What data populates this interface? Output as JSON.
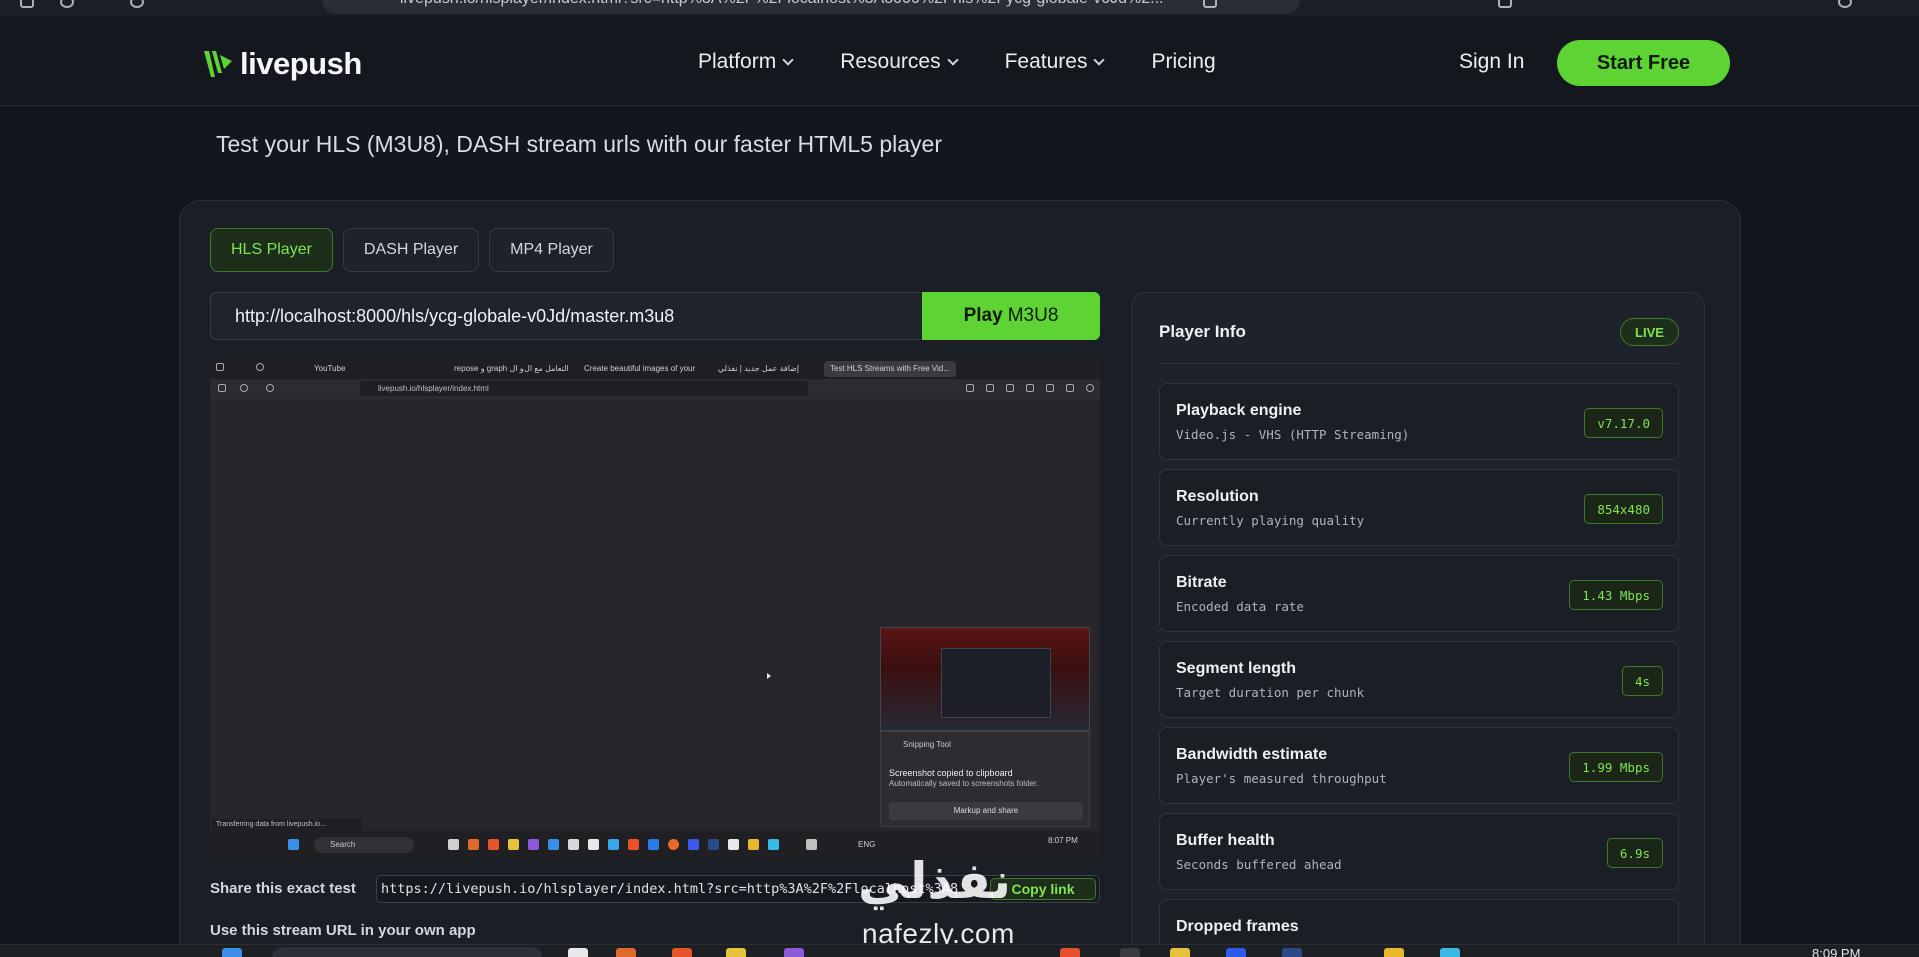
{
  "browser": {
    "url": "livepush.io/hlsplayer/index.html?src=http%3A%2F%2Flocalhost%3A8000%2Fhls%2Fycg-globale-v0Jd%2..."
  },
  "header": {
    "logo_text": "livepush",
    "nav": [
      {
        "label": "Platform",
        "has_dropdown": true
      },
      {
        "label": "Resources",
        "has_dropdown": true
      },
      {
        "label": "Features",
        "has_dropdown": true
      },
      {
        "label": "Pricing",
        "has_dropdown": false
      }
    ],
    "sign_in": "Sign In",
    "start_free": "Start Free"
  },
  "tagline": "Test your HLS (M3U8), DASH stream urls with our faster HTML5 player",
  "player_tabs": [
    {
      "label": "HLS Player",
      "active": true
    },
    {
      "label": "DASH Player",
      "active": false
    },
    {
      "label": "MP4 Player",
      "active": false
    }
  ],
  "stream_url": "http://localhost:8000/hls/ycg-globale-v0Jd/master.m3u8",
  "play_button": {
    "bold": "Play",
    "rest": "M3U8"
  },
  "player_screen": {
    "tabs": [
      "YouTube",
      "repose و graph و ال",
      "التعامل مع ال",
      "Create beautiful images of your",
      "إضافة عمل جديد | نفذلي",
      "Test HLS Streams with Free Vid..."
    ],
    "address": "livepush.io/hlsplayer/index.html",
    "status": "Transferring data from livepush.io...",
    "taskbar_search": "Search",
    "snip": {
      "app": "Snipping Tool",
      "title": "Screenshot copied to clipboard",
      "detail": "Automatically saved to screenshots folder.",
      "button": "Markup and share"
    },
    "tray": {
      "lang": "ENG",
      "time": "8:07 PM"
    }
  },
  "share": {
    "label": "Share this exact test",
    "url": "https://livepush.io/hlsplayer/index.html?src=http%3A%2F%2Flocalhost%3A8",
    "copy": "Copy link"
  },
  "use_url_label": "Use this stream URL in your own app",
  "player_info": {
    "title": "Player Info",
    "badge": "LIVE",
    "items": [
      {
        "label": "Playback engine",
        "sub": "Video.js - VHS (HTTP Streaming)",
        "value": "v7.17.0"
      },
      {
        "label": "Resolution",
        "sub": "Currently playing quality",
        "value": "854x480"
      },
      {
        "label": "Bitrate",
        "sub": "Encoded data rate",
        "value": "1.43 Mbps"
      },
      {
        "label": "Segment length",
        "sub": "Target duration per chunk",
        "value": "4s"
      },
      {
        "label": "Bandwidth estimate",
        "sub": "Player's measured throughput",
        "value": "1.99 Mbps"
      },
      {
        "label": "Buffer health",
        "sub": "Seconds buffered ahead",
        "value": "6.9s"
      },
      {
        "label": "Dropped frames",
        "sub": "",
        "value": ""
      }
    ]
  },
  "watermark": {
    "arabic": "نفذلي",
    "latin": "nafezly.com"
  },
  "os_clock": "8:09 PM",
  "colors": {
    "accent": "#5ed334",
    "accent_text": "#7fe352",
    "bg": "#12161d",
    "card": "#1a1e25"
  }
}
